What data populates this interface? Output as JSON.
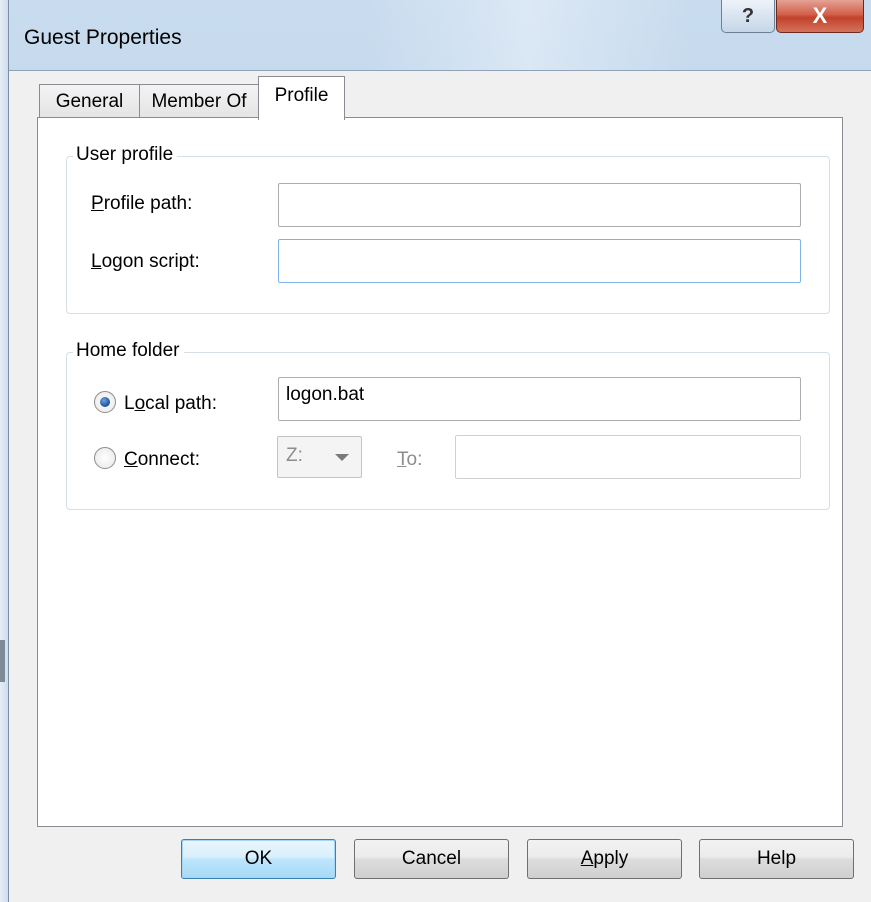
{
  "window": {
    "title": "Guest Properties",
    "help_glyph": "?",
    "close_glyph": "X"
  },
  "tabs": [
    {
      "label": "General",
      "active": false
    },
    {
      "label": "Member Of",
      "active": false
    },
    {
      "label": "Profile",
      "active": true
    }
  ],
  "user_profile": {
    "group_title": "User profile",
    "profile_path_label": "Profile path:",
    "profile_path_value": "",
    "logon_script_label": "Logon script:",
    "logon_script_value": ""
  },
  "home_folder": {
    "group_title": "Home folder",
    "local_path_label": "Local path:",
    "local_path_selected": true,
    "local_path_value": "logon.bat",
    "connect_label": "Connect:",
    "connect_selected": false,
    "drive_value": "Z:",
    "to_label": "To:",
    "to_value": ""
  },
  "buttons": {
    "ok": "OK",
    "cancel": "Cancel",
    "apply": "Apply",
    "help": "Help"
  },
  "colors": {
    "title_bar": "#bcd3ea",
    "close_button": "#c2412a",
    "client_bg": "#f0f0f0",
    "default_button_border": "#3c7fb1"
  }
}
